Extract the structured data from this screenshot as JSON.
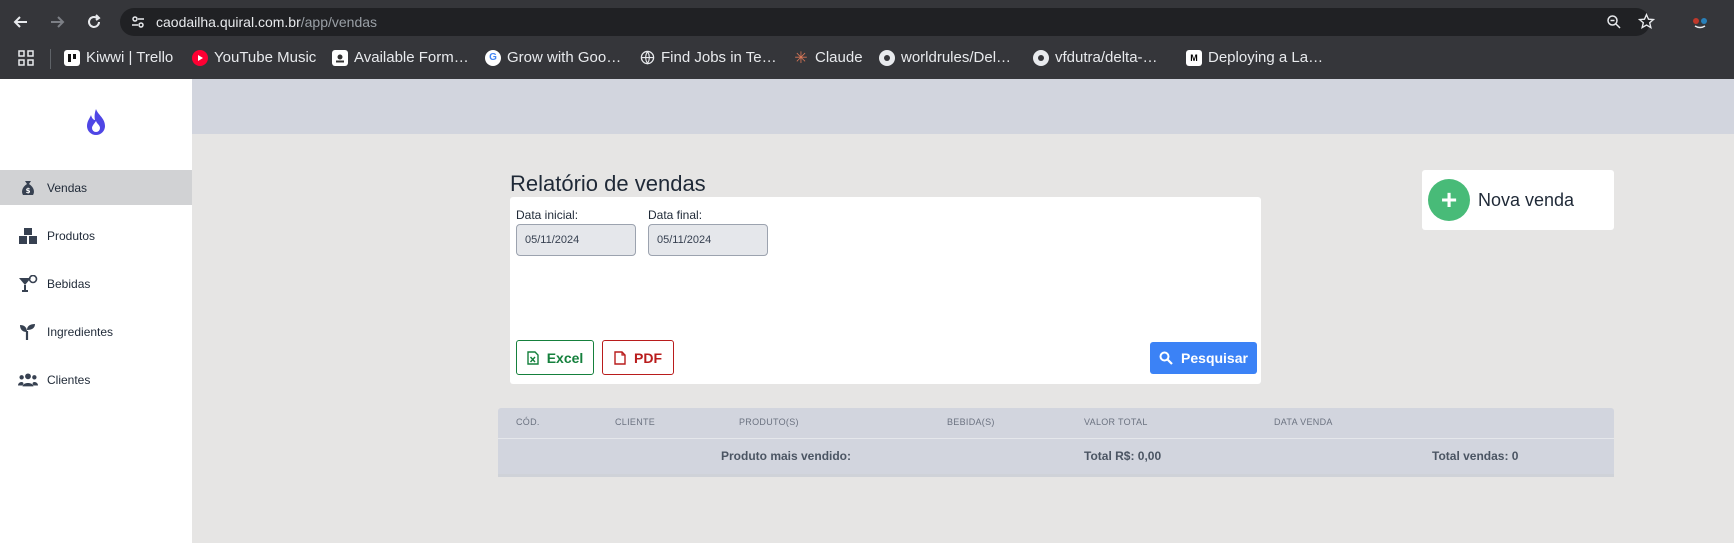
{
  "browser": {
    "url_host": "caodailha.quiral.com.br",
    "url_path": "/app/vendas",
    "bookmarks": [
      {
        "label": "Kiwwi | Trello",
        "icon": "trello-icon"
      },
      {
        "label": "YouTube Music",
        "icon": "youtube-music-icon"
      },
      {
        "label": "Available Form…",
        "icon": "form-icon"
      },
      {
        "label": "Grow with Goo…",
        "icon": "google-icon"
      },
      {
        "label": "Find Jobs in Te…",
        "icon": "globe-icon"
      },
      {
        "label": "Claude",
        "icon": "claude-icon"
      },
      {
        "label": "worldrules/Del…",
        "icon": "github-icon"
      },
      {
        "label": "vfdutra/delta-…",
        "icon": "github-icon"
      },
      {
        "label": "Deploying a La…",
        "icon": "medium-icon"
      }
    ]
  },
  "sidebar": {
    "items": [
      {
        "label": "Vendas",
        "icon": "money-bag-icon",
        "active": true
      },
      {
        "label": "Produtos",
        "icon": "boxes-icon"
      },
      {
        "label": "Bebidas",
        "icon": "cocktail-icon"
      },
      {
        "label": "Ingredientes",
        "icon": "seedling-icon"
      },
      {
        "label": "Clientes",
        "icon": "users-icon"
      }
    ]
  },
  "main": {
    "title": "Relatório de vendas",
    "filters": {
      "start_label": "Data inicial:",
      "start_value": "05/11/2024",
      "end_label": "Data final:",
      "end_value": "05/11/2024"
    },
    "buttons": {
      "excel": "Excel",
      "pdf": "PDF",
      "search": "Pesquisar",
      "new_sale": "Nova venda"
    },
    "table": {
      "columns": [
        "CÓD.",
        "CLIENTE",
        "PRODUTO(S)",
        "BEBIDA(S)",
        "VALOR TOTAL",
        "DATA VENDA"
      ],
      "rows": [],
      "footer": {
        "best_seller": "Produto mais vendido:",
        "total": "Total R$: 0,00",
        "count": "Total vendas: 0"
      }
    }
  },
  "colors": {
    "accent_blue": "#3b82f6",
    "excel_green": "#15803d",
    "pdf_red": "#b91c1c",
    "new_sale_green": "#48bb78",
    "logo_indigo": "#4f46e5"
  }
}
